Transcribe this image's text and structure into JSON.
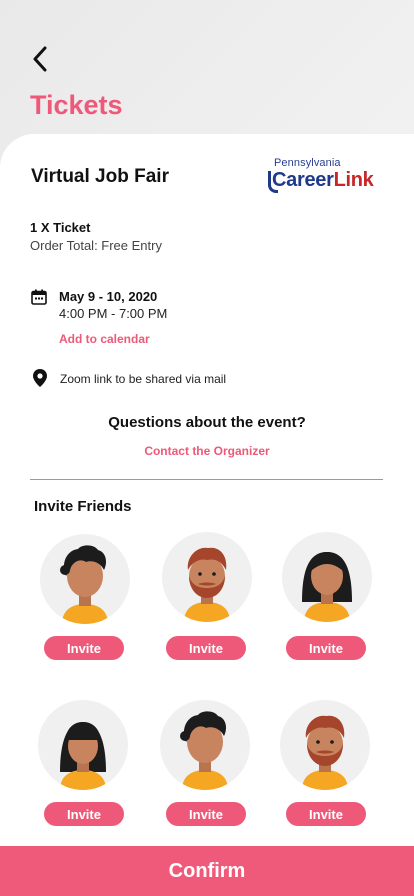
{
  "header": {
    "title": "Tickets",
    "back_icon": "chevron-left-icon"
  },
  "event": {
    "name": "Virtual Job Fair",
    "logo": {
      "top_text": "Pennsylvania",
      "main_text_a": "Career",
      "main_text_b": "Link"
    },
    "ticket": "1 X  Ticket",
    "order_total": "Order Total: Free Entry",
    "date": "May 9 - 10, 2020",
    "time": "4:00 PM - 7:00 PM",
    "add_to_calendar": "Add to calendar",
    "location": "Zoom link to be shared via mail"
  },
  "questions": {
    "title": "Questions about the event?",
    "contact": "Contact the Organizer"
  },
  "invite": {
    "title": "Invite Friends",
    "button_label": "Invite",
    "friends": [
      {
        "avatar": "avatar-curly-hair"
      },
      {
        "avatar": "avatar-beard-red"
      },
      {
        "avatar": "avatar-long-hair"
      },
      {
        "avatar": "avatar-bangs-hair"
      },
      {
        "avatar": "avatar-curly-hair"
      },
      {
        "avatar": "avatar-beard-red"
      }
    ]
  },
  "footer": {
    "confirm": "Confirm"
  },
  "colors": {
    "accent": "#ee5879",
    "skin": "#c8845e",
    "shirt": "#f5a623",
    "hair_dark": "#1c1c1c",
    "hair_red": "#a5452c"
  }
}
